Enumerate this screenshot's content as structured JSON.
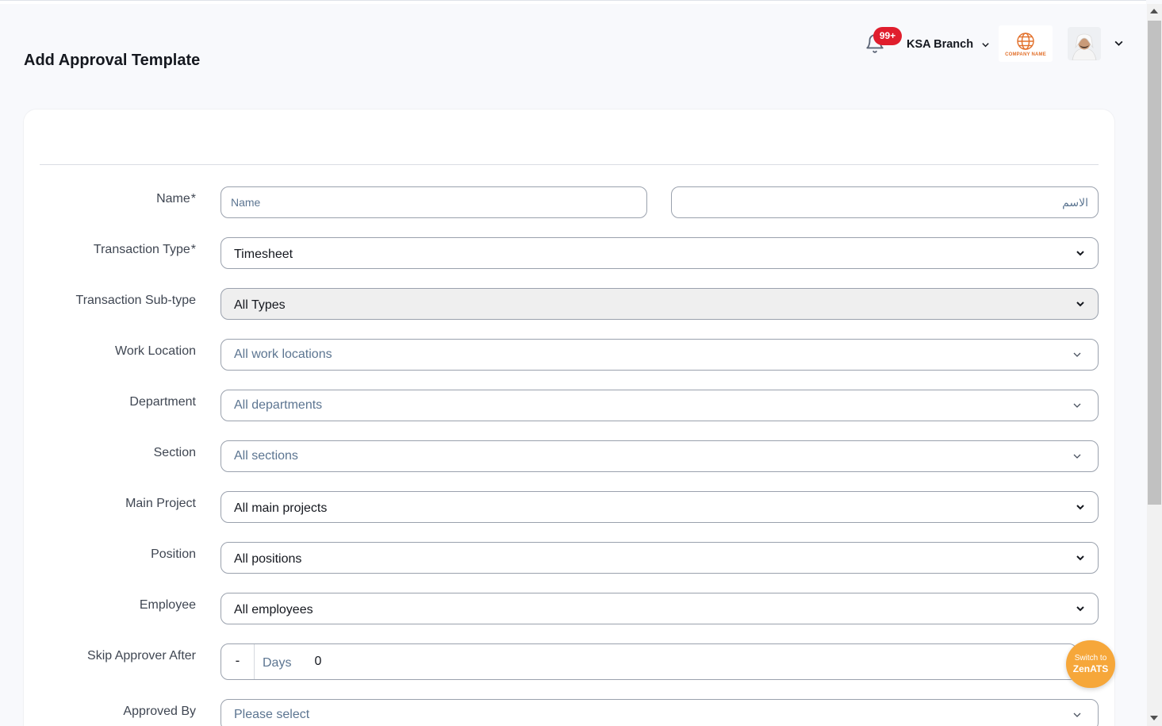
{
  "page": {
    "title": "Add Approval Template"
  },
  "header": {
    "notification_count": "99+",
    "branch": "KSA Branch",
    "company_logo_text": "COMPANY NAME"
  },
  "form": {
    "name": {
      "label": "Name",
      "required_mark": "*",
      "placeholder_en": "Name",
      "placeholder_ar": "الاسم"
    },
    "transaction_type": {
      "label": "Transaction Type",
      "required_mark": "*",
      "value": "Timesheet"
    },
    "transaction_subtype": {
      "label": "Transaction Sub-type",
      "value": "All Types"
    },
    "work_location": {
      "label": "Work Location",
      "placeholder": "All work locations"
    },
    "department": {
      "label": "Department",
      "placeholder": "All departments"
    },
    "section": {
      "label": "Section",
      "placeholder": "All sections"
    },
    "main_project": {
      "label": "Main Project",
      "value": "All main projects"
    },
    "position": {
      "label": "Position",
      "value": "All positions"
    },
    "employee": {
      "label": "Employee",
      "value": "All employees"
    },
    "skip_approver": {
      "label": "Skip Approver After",
      "minus": "-",
      "unit": "Days",
      "value": "0"
    },
    "approved_by": {
      "label": "Approved By",
      "placeholder": "Please select"
    }
  },
  "fab": {
    "line1": "Switch to",
    "line2": "ZenATS"
  },
  "colors": {
    "badge": "#e01e2d",
    "fab": "#f6a73a",
    "logo": "#e2702b"
  }
}
